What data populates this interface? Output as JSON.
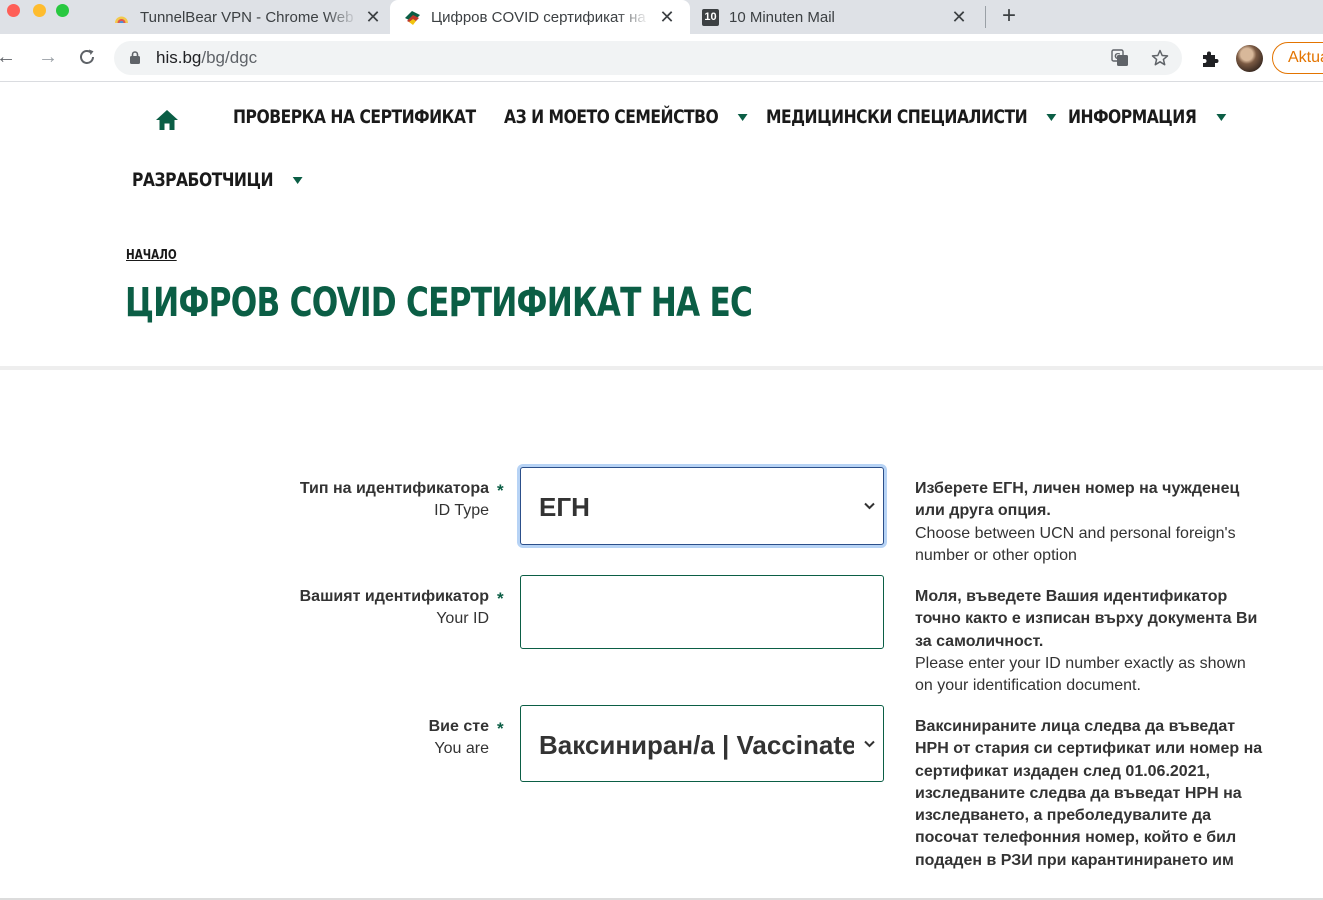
{
  "browser": {
    "tabs": [
      {
        "title": "TunnelBear VPN - Chrome Web Store",
        "active": false
      },
      {
        "title": "Цифров COVID сертификат на ЕС",
        "active": true
      },
      {
        "title": "10 Minuten Mail",
        "active": false
      }
    ],
    "tab3_favicon_text": "10",
    "url_host": "his.bg",
    "url_path": "/bg/dgc",
    "update_label": "Aktualisieren"
  },
  "nav": {
    "items": [
      {
        "label": "ПРОВЕРКА НА СЕРТИФИКАТ",
        "has_dropdown": false
      },
      {
        "label": "АЗ И МОЕТО СЕМЕЙСТВО",
        "has_dropdown": true
      },
      {
        "label": "МЕДИЦИНСКИ СПЕЦИАЛИСТИ",
        "has_dropdown": true
      },
      {
        "label": "ИНФОРМАЦИЯ",
        "has_dropdown": true
      },
      {
        "label": "РАЗРАБОТЧИЦИ",
        "has_dropdown": true
      }
    ]
  },
  "header": {
    "breadcrumb": "НАЧАЛО",
    "title": "ЦИФРОВ COVID СЕРТИФИКАТ НА ЕС"
  },
  "form": {
    "required_mark": "*",
    "fields": [
      {
        "label_bg": "Тип на идентификатора",
        "label_en": "ID Type",
        "value": "ЕГН",
        "help_bg": "Изберете ЕГН, личен номер на чужденец или друга опция.",
        "help_en": "Choose between UCN and personal foreign's number or other option"
      },
      {
        "label_bg": "Вашият идентификатор",
        "label_en": "Your ID",
        "value": "",
        "help_bg": "Моля, въведете Вашия идентификатор точно както е изписан върху документа Ви за самоличност.",
        "help_en": "Please enter your ID number exactly as shown on your identification document."
      },
      {
        "label_bg": "Вие сте",
        "label_en": "You are",
        "value": "Ваксиниран/а | Vaccinated",
        "help_bg": "Ваксинираните лица следва да въведат НРН от стария си сертификат или номер на сертификат издаден след 01.06.2021, изследваните следва да въведат НРН на изследването, а преболедувалите да посочат телефонния номер, който е бил подаден в РЗИ при карантинирането им",
        "help_en": ""
      }
    ]
  },
  "colors": {
    "brand_green": "#0b5e45",
    "focus_ring": "#b7d3f5",
    "update_orange": "#e37400"
  }
}
